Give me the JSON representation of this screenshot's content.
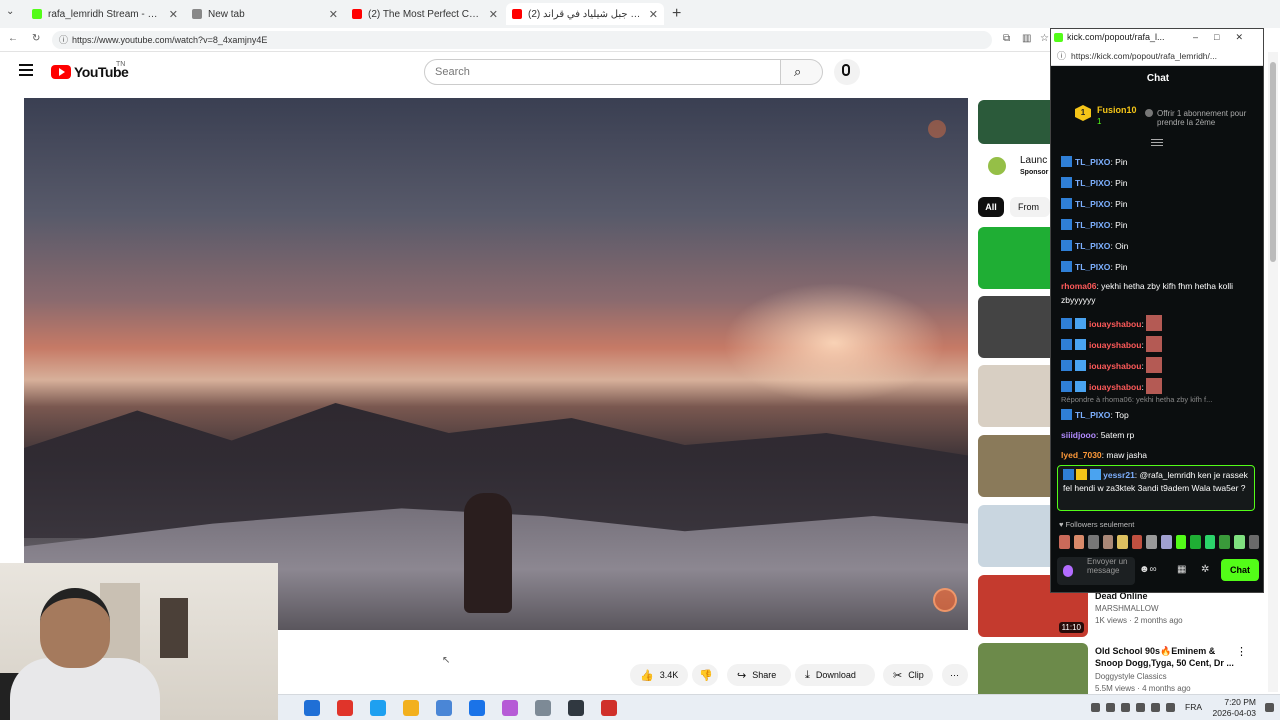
{
  "browser": {
    "tabs": [
      {
        "title": "rafa_lemridh Stream - Watch Live",
        "favicon_color": "#53fc18",
        "active": false
      },
      {
        "title": "New tab",
        "favicon_color": "#888888",
        "active": false
      },
      {
        "title": "(2) The Most Perfect Country on th",
        "favicon_color": "#ff0000",
        "active": false
      },
      {
        "title": "(2) حل لغز جبل شيلياد في قراند",
        "favicon_color": "#ff0000",
        "active": true
      }
    ],
    "new_tab_label": "+",
    "url": "https://www.youtube.com/watch?v=8_4xamjny4E"
  },
  "youtube": {
    "logo_text": "YouTube",
    "country_code": "TN",
    "search_placeholder": "Search",
    "ad": {
      "title": "Launc",
      "label": "Sponsor"
    },
    "chips": {
      "all": "All",
      "from": "From"
    },
    "actions": {
      "likes": "3.4K",
      "share": "Share",
      "download": "Download",
      "clip": "Clip",
      "more": "⋯"
    },
    "recommendations": [
      {
        "title": "Dead Online",
        "channel": "MARSHMALLOW",
        "meta": "1K views · 2 months ago",
        "duration": "11:10",
        "thumb_color": "#c43a2e"
      },
      {
        "title": "Old School 90s🔥Eminem & Snoop Dogg,Tyga, 50 Cent, Dr ...",
        "channel": "Doggystyle Classics",
        "meta": "5.5M views · 4 months ago",
        "duration": "",
        "thumb_color": "#6c8a4a"
      }
    ],
    "thumb_colors": [
      "#2b5a3a",
      "#1fae34",
      "#444444",
      "#d8cfc3",
      "#8a7a5a",
      "#c9d6e0"
    ]
  },
  "kick": {
    "window_title": "kick.com/popout/rafa_l...",
    "url": "https://kick.com/popout/rafa_lemridh/...",
    "chat_header": "Chat",
    "sub_user": "Fusion10",
    "sub_count": "1",
    "sub_badge": "1",
    "gift_text": "Offrir 1 abonnement pour prendre la 2ème",
    "messages": [
      {
        "user": "TL_PIXO",
        "text": "Pin",
        "color": "u-blue",
        "badges": 1
      },
      {
        "user": "TL_PIXO",
        "text": "Pin",
        "color": "u-blue",
        "badges": 1
      },
      {
        "user": "TL_PIXO",
        "text": "Pin",
        "color": "u-blue",
        "badges": 1
      },
      {
        "user": "TL_PIXO",
        "text": "Pin",
        "color": "u-blue",
        "badges": 1
      },
      {
        "user": "TL_PIXO",
        "text": "Oin",
        "color": "u-blue",
        "badges": 1
      },
      {
        "user": "TL_PIXO",
        "text": "Pin",
        "color": "u-blue",
        "badges": 1
      },
      {
        "user": "rhoma06",
        "text": "yekhi hetha zby kifh fhm hetha kolli zbyyyyyy",
        "color": "u-red",
        "badges": 0
      },
      {
        "user": "iouayshabou",
        "text": "",
        "color": "u-red",
        "badges": 2
      },
      {
        "user": "iouayshabou",
        "text": "",
        "color": "u-red",
        "badges": 2
      },
      {
        "user": "iouayshabou",
        "text": "",
        "color": "u-red",
        "badges": 2
      },
      {
        "user": "iouayshabou",
        "text": "",
        "color": "u-red",
        "badges": 2
      },
      {
        "user": "TL_PIXO",
        "text": "Top",
        "color": "u-blue",
        "badges": 1
      },
      {
        "user": "siiidjooo",
        "text": "5atem rp",
        "color": "u-purple",
        "badges": 0
      },
      {
        "user": "lyed_7030",
        "text": "maw jasha",
        "color": "u-orange",
        "badges": 0
      }
    ],
    "reply_hint": "Répondre à rhoma06: yekhi hetha zby kifh f...",
    "highlight": {
      "user": "yessr21",
      "text": "@rafa_lemridh ken je rassek fel hendi w za3ktek 3andi t9adem Wala twa5er ?"
    },
    "followers_only": "Followers seulement",
    "input_placeholder": "Envoyer un message",
    "send_label": "Chat",
    "emote_colors": [
      "#c96a5a",
      "#d98a6a",
      "#777777",
      "#aa8877",
      "#ddc060",
      "#c05040",
      "#999999",
      "#a0a0d0",
      "#53fc18",
      "#1fae34",
      "#2bd46a",
      "#3a9a3a",
      "#7fe07f",
      "#6a6a6a"
    ]
  },
  "taskbar": {
    "app_colors": [
      "#1f6fd6",
      "#e0342a",
      "#1ea0f0",
      "#f2b01e",
      "#4a86d6",
      "#1a73e8",
      "#b65bd6",
      "#7d8a96",
      "#303840",
      "#d0302a"
    ],
    "language": "FRA",
    "time": "7:20 PM",
    "date": "2026-04-03"
  },
  "colors": {
    "kick_green": "#53fc18",
    "youtube_red": "#ff0000"
  }
}
